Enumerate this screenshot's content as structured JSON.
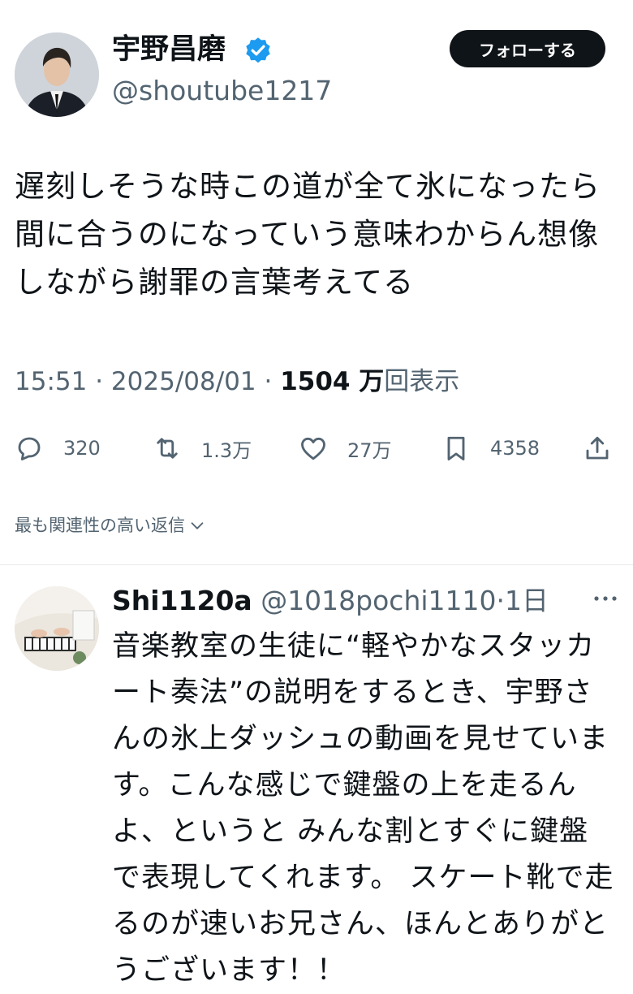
{
  "author": {
    "name": "宇野昌磨",
    "handle": "@shoutube1217",
    "avatar_icon": "profile-photo"
  },
  "follow_button": {
    "label": "フォローする"
  },
  "tweet": {
    "text": "遅刻しそうな時この道が全て氷になったら間に合うのになっていう意味わからん想像しながら謝罪の言葉考えてる",
    "time": "15:51",
    "date": "2025/08/01",
    "views_count": "1504 万",
    "views_label": "回表示"
  },
  "actions": {
    "replies": "320",
    "retweets": "1.3万",
    "likes": "27万",
    "bookmarks": "4358"
  },
  "replies_sort": {
    "label": "最も関連性の高い返信"
  },
  "reply": {
    "name": "Shi1120a",
    "handle": "@1018pochi1110",
    "age": "1日",
    "text": "音楽教室の生徒に“軽やかなスタッカート奏法”の説明をするとき、宇野さんの氷上ダッシュの動画を見せています。こんな感じで鍵盤の上を走るんよ、というと みんな割とすぐに鍵盤で表現してくれます。 スケート靴で走るのが速いお兄さん、ほんとありがとうございます！！"
  },
  "colors": {
    "verified_blue": "#1d9bf0",
    "muted_text": "#536471",
    "primary_text": "#0f1419"
  }
}
